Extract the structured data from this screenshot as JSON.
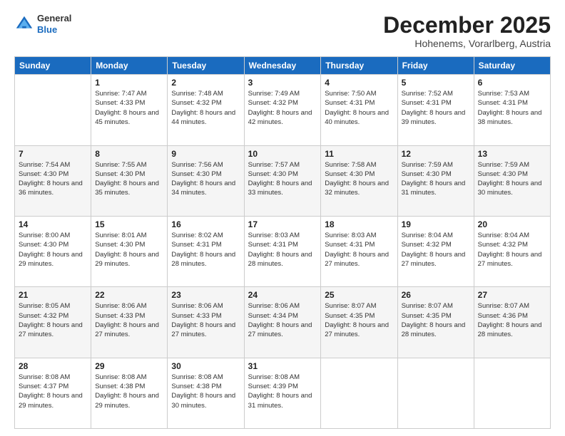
{
  "header": {
    "logo": {
      "general": "General",
      "blue": "Blue"
    },
    "title": "December 2025",
    "location": "Hohenems, Vorarlberg, Austria"
  },
  "weekdays": [
    "Sunday",
    "Monday",
    "Tuesday",
    "Wednesday",
    "Thursday",
    "Friday",
    "Saturday"
  ],
  "weeks": [
    [
      {
        "day": "",
        "sunrise": "",
        "sunset": "",
        "daylight": ""
      },
      {
        "day": "1",
        "sunrise": "Sunrise: 7:47 AM",
        "sunset": "Sunset: 4:33 PM",
        "daylight": "Daylight: 8 hours and 45 minutes."
      },
      {
        "day": "2",
        "sunrise": "Sunrise: 7:48 AM",
        "sunset": "Sunset: 4:32 PM",
        "daylight": "Daylight: 8 hours and 44 minutes."
      },
      {
        "day": "3",
        "sunrise": "Sunrise: 7:49 AM",
        "sunset": "Sunset: 4:32 PM",
        "daylight": "Daylight: 8 hours and 42 minutes."
      },
      {
        "day": "4",
        "sunrise": "Sunrise: 7:50 AM",
        "sunset": "Sunset: 4:31 PM",
        "daylight": "Daylight: 8 hours and 40 minutes."
      },
      {
        "day": "5",
        "sunrise": "Sunrise: 7:52 AM",
        "sunset": "Sunset: 4:31 PM",
        "daylight": "Daylight: 8 hours and 39 minutes."
      },
      {
        "day": "6",
        "sunrise": "Sunrise: 7:53 AM",
        "sunset": "Sunset: 4:31 PM",
        "daylight": "Daylight: 8 hours and 38 minutes."
      }
    ],
    [
      {
        "day": "7",
        "sunrise": "Sunrise: 7:54 AM",
        "sunset": "Sunset: 4:30 PM",
        "daylight": "Daylight: 8 hours and 36 minutes."
      },
      {
        "day": "8",
        "sunrise": "Sunrise: 7:55 AM",
        "sunset": "Sunset: 4:30 PM",
        "daylight": "Daylight: 8 hours and 35 minutes."
      },
      {
        "day": "9",
        "sunrise": "Sunrise: 7:56 AM",
        "sunset": "Sunset: 4:30 PM",
        "daylight": "Daylight: 8 hours and 34 minutes."
      },
      {
        "day": "10",
        "sunrise": "Sunrise: 7:57 AM",
        "sunset": "Sunset: 4:30 PM",
        "daylight": "Daylight: 8 hours and 33 minutes."
      },
      {
        "day": "11",
        "sunrise": "Sunrise: 7:58 AM",
        "sunset": "Sunset: 4:30 PM",
        "daylight": "Daylight: 8 hours and 32 minutes."
      },
      {
        "day": "12",
        "sunrise": "Sunrise: 7:59 AM",
        "sunset": "Sunset: 4:30 PM",
        "daylight": "Daylight: 8 hours and 31 minutes."
      },
      {
        "day": "13",
        "sunrise": "Sunrise: 7:59 AM",
        "sunset": "Sunset: 4:30 PM",
        "daylight": "Daylight: 8 hours and 30 minutes."
      }
    ],
    [
      {
        "day": "14",
        "sunrise": "Sunrise: 8:00 AM",
        "sunset": "Sunset: 4:30 PM",
        "daylight": "Daylight: 8 hours and 29 minutes."
      },
      {
        "day": "15",
        "sunrise": "Sunrise: 8:01 AM",
        "sunset": "Sunset: 4:30 PM",
        "daylight": "Daylight: 8 hours and 29 minutes."
      },
      {
        "day": "16",
        "sunrise": "Sunrise: 8:02 AM",
        "sunset": "Sunset: 4:31 PM",
        "daylight": "Daylight: 8 hours and 28 minutes."
      },
      {
        "day": "17",
        "sunrise": "Sunrise: 8:03 AM",
        "sunset": "Sunset: 4:31 PM",
        "daylight": "Daylight: 8 hours and 28 minutes."
      },
      {
        "day": "18",
        "sunrise": "Sunrise: 8:03 AM",
        "sunset": "Sunset: 4:31 PM",
        "daylight": "Daylight: 8 hours and 27 minutes."
      },
      {
        "day": "19",
        "sunrise": "Sunrise: 8:04 AM",
        "sunset": "Sunset: 4:32 PM",
        "daylight": "Daylight: 8 hours and 27 minutes."
      },
      {
        "day": "20",
        "sunrise": "Sunrise: 8:04 AM",
        "sunset": "Sunset: 4:32 PM",
        "daylight": "Daylight: 8 hours and 27 minutes."
      }
    ],
    [
      {
        "day": "21",
        "sunrise": "Sunrise: 8:05 AM",
        "sunset": "Sunset: 4:32 PM",
        "daylight": "Daylight: 8 hours and 27 minutes."
      },
      {
        "day": "22",
        "sunrise": "Sunrise: 8:06 AM",
        "sunset": "Sunset: 4:33 PM",
        "daylight": "Daylight: 8 hours and 27 minutes."
      },
      {
        "day": "23",
        "sunrise": "Sunrise: 8:06 AM",
        "sunset": "Sunset: 4:33 PM",
        "daylight": "Daylight: 8 hours and 27 minutes."
      },
      {
        "day": "24",
        "sunrise": "Sunrise: 8:06 AM",
        "sunset": "Sunset: 4:34 PM",
        "daylight": "Daylight: 8 hours and 27 minutes."
      },
      {
        "day": "25",
        "sunrise": "Sunrise: 8:07 AM",
        "sunset": "Sunset: 4:35 PM",
        "daylight": "Daylight: 8 hours and 27 minutes."
      },
      {
        "day": "26",
        "sunrise": "Sunrise: 8:07 AM",
        "sunset": "Sunset: 4:35 PM",
        "daylight": "Daylight: 8 hours and 28 minutes."
      },
      {
        "day": "27",
        "sunrise": "Sunrise: 8:07 AM",
        "sunset": "Sunset: 4:36 PM",
        "daylight": "Daylight: 8 hours and 28 minutes."
      }
    ],
    [
      {
        "day": "28",
        "sunrise": "Sunrise: 8:08 AM",
        "sunset": "Sunset: 4:37 PM",
        "daylight": "Daylight: 8 hours and 29 minutes."
      },
      {
        "day": "29",
        "sunrise": "Sunrise: 8:08 AM",
        "sunset": "Sunset: 4:38 PM",
        "daylight": "Daylight: 8 hours and 29 minutes."
      },
      {
        "day": "30",
        "sunrise": "Sunrise: 8:08 AM",
        "sunset": "Sunset: 4:38 PM",
        "daylight": "Daylight: 8 hours and 30 minutes."
      },
      {
        "day": "31",
        "sunrise": "Sunrise: 8:08 AM",
        "sunset": "Sunset: 4:39 PM",
        "daylight": "Daylight: 8 hours and 31 minutes."
      },
      {
        "day": "",
        "sunrise": "",
        "sunset": "",
        "daylight": ""
      },
      {
        "day": "",
        "sunrise": "",
        "sunset": "",
        "daylight": ""
      },
      {
        "day": "",
        "sunrise": "",
        "sunset": "",
        "daylight": ""
      }
    ]
  ]
}
